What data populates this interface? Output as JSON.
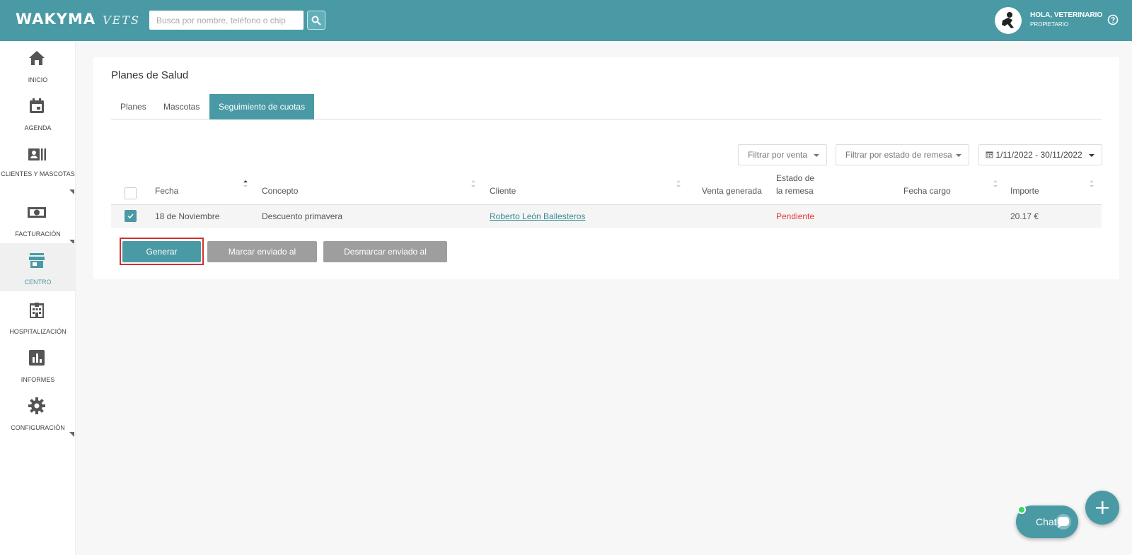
{
  "header": {
    "logo_main": "WAKYMA",
    "logo_sub": "VETS",
    "search_placeholder": "Busca por nombre, teléfono o chip",
    "user_greeting": "HOLA, VETERINARIO",
    "user_role": "PROPIETARIO",
    "brand_color": "#4a9aa5"
  },
  "sidebar": {
    "items": [
      {
        "label": "INICIO",
        "icon": "home-icon"
      },
      {
        "label": "AGENDA",
        "icon": "calendar-icon"
      },
      {
        "label": "CLIENTES Y MASCOTAS",
        "icon": "contacts-icon"
      },
      {
        "label": "FACTURACIÓN",
        "icon": "money-icon"
      },
      {
        "label": "CENTRO",
        "icon": "store-icon",
        "active": true
      },
      {
        "label": "HOSPITALIZACIÓN",
        "icon": "hospital-icon"
      },
      {
        "label": "INFORMES",
        "icon": "chart-icon"
      },
      {
        "label": "CONFIGURACIÓN",
        "icon": "gear-icon"
      }
    ]
  },
  "page": {
    "title": "Planes de Salud",
    "tabs": [
      "Planes",
      "Mascotas",
      "Seguimiento de cuotas"
    ],
    "active_tab": "Seguimiento de cuotas"
  },
  "filters": {
    "venta": "Filtrar por venta",
    "estado": "Filtrar por estado de remesa",
    "date_range": "1/11/2022 - 30/11/2022"
  },
  "table": {
    "headers": {
      "fecha": "Fecha",
      "concepto": "Concepto",
      "cliente": "Cliente",
      "venta": "Venta generada",
      "estado_1": "Estado de",
      "estado_2": "la remesa",
      "fecha_cargo": "Fecha cargo",
      "importe": "Importe"
    },
    "rows": [
      {
        "checked": true,
        "fecha": "18 de Noviembre",
        "concepto": "Descuento primavera",
        "cliente": "Roberto León Ballesteros",
        "venta": "",
        "estado": "Pendiente",
        "fecha_cargo": "",
        "importe": "20.17 €"
      }
    ]
  },
  "actions": {
    "generar": "Generar remesa",
    "marcar": "Marcar enviado al banco",
    "desmarcar": "Desmarcar enviado al banco"
  },
  "chat": {
    "label": "Chat"
  },
  "colors": {
    "status_pending": "#e53935",
    "highlight": "#d32f2f"
  }
}
